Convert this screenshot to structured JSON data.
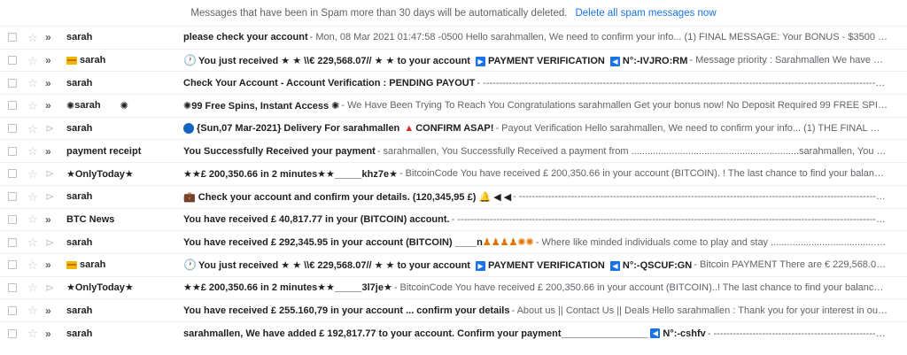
{
  "banner": {
    "text": "Messages that have been in Spam more than 30 days will be automatically deleted.",
    "link": "Delete all spam messages now"
  },
  "rows": [
    {
      "sender": "sarah",
      "subject": "please check your account",
      "snippet": " - Mon, 08 Mar 2021 01:47:58 -0500 Hello sarahmallen, We need to confirm your info... (1) FINAL MESSAGE: Your BONUS - $3500 is ready to be addressed in your Na..."
    },
    {
      "sender": "sarah",
      "subject": "You just received ★ ★ \\\\€ 229,568.07// ★ ★ to your account",
      "tag1": "▶",
      "subject2": "PAYMENT VERIFICATION",
      "tag2": "◀",
      "subject3": "N°:-IVJRO:RM",
      "snippet": " - Message priority : Sarahmallen We have not received your confirmation. Pay..."
    },
    {
      "sender": "sarah",
      "subject": "Check Your Account - Account Verification : PENDING PAYOUT",
      "snippet": " - ----------------------------------------------------------------------------------------------------------------------------------------"
    },
    {
      "sender": "sarah",
      "sender_deco": "✺",
      "subject": "99 Free Spins, Instant Access",
      "snippet": " - We Have Been Trying To Reach You Congratulations sarahmallen Get your bonus now! No Deposit Required 99 FREE SPINS JOIN NOW Unsubscribe If you..."
    },
    {
      "sender": "sarah",
      "subject": "{Sun,07 Mar-2021} Delivery For sarahmallen",
      "warn": "▲",
      "subject2": "CONFIRM ASAP!",
      "snippet": " - Payout Verification Hello sarahmallen, We need to confirm your info... (1) THE FINAL MESSAGE : Payout_Verification - Y..."
    },
    {
      "sender": "payment receipt",
      "subject": "You Successfully Received your payment",
      "snippet": " - sarahmallen, You Successfully Received a payment from ..............................................................sarahmallen, You Successfully Received a payment from"
    },
    {
      "sender": "★OnlyToday★",
      "subject": "★★£ 200,350.66 in 2 minutes★★_____khz7e★",
      "snippet": " - BitcoinCode You have received £ 200,350.66 in your account (BITCOIN). ! The last chance to find your balance! Account information : - Name:"
    },
    {
      "sender": "sarah",
      "subject": "Check your account and confirm your details. (120,345,95 £)",
      "icons": "🔔 ◀ ◀",
      "snippet": " - --------------------------------------------------------------------------------------------------------------------------------"
    },
    {
      "sender": "BTC News",
      "subject": "You have received £ 40,817.77 in your (BITCOIN) account.",
      "snippet": " - -------------------------------------------------------------------------------------------------------------------------------------------"
    },
    {
      "sender": "sarah",
      "subject": "You have received £ 292,345.95 in your account (BITCOIN) ____n",
      "icons": "♟♟♟♟✺✺",
      "snippet": " - Where like minded individuals come to play and stay .........................................................................................BRU3hckGviC..."
    },
    {
      "sender": "sarah",
      "subject": "You just received ★ ★ \\\\€ 229,568.07// ★ ★ to your account",
      "tag1": "▶",
      "subject2": "PAYMENT VERIFICATION",
      "tag2": "◀",
      "subject3": "N°:-QSCUF:GN",
      "snippet": " - Bitcoin PAYMENT There are € 229,568.07 in your account, you only have 3 h..."
    },
    {
      "sender": "★OnlyToday★",
      "subject": "★★£ 200,350.66 in 2 minutes★★_____3l7je★",
      "snippet": " - BitcoinCode You have received £ 200,350.66 in your account (BITCOIN)..! The last chance to find your balance! Account information : - Name:"
    },
    {
      "sender": "sarah",
      "subject": "You have received £ 255.160,79 in your account ... confirm your details",
      "snippet": " - About us || Contact Us || Deals Hello sarahmallen : Thank you for your interest in our investment program. We tried to ..."
    },
    {
      "sender": "sarah",
      "subject": "sarahmallen, We have added £ 192,817.77 to your account. Confirm your payment________________",
      "tag1": "◀",
      "subject2": "N°:-cshfv",
      "snippet": " - -----------------------------------------------------------------------------------------"
    }
  ]
}
